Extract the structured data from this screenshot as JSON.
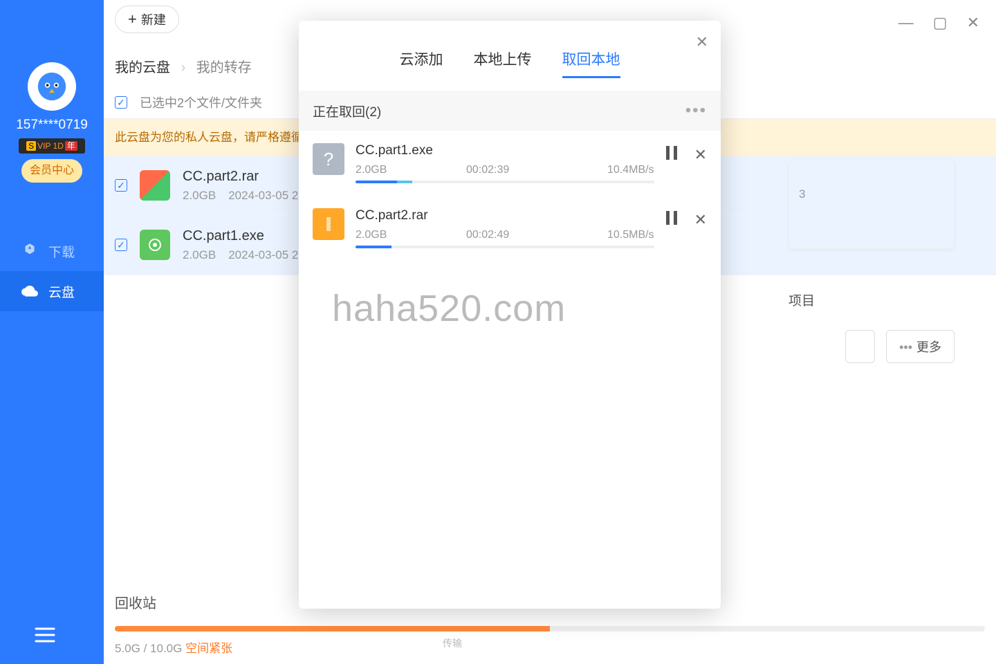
{
  "sidebar": {
    "username": "157****0719",
    "vip_label": "VIP 1D",
    "member_btn": "会员中心",
    "items": [
      {
        "label": "下载"
      },
      {
        "label": "云盘"
      }
    ]
  },
  "topbar": {
    "new_btn": "新建"
  },
  "breadcrumb": {
    "root": "我的云盘",
    "current": "我的转存"
  },
  "select_bar": "已选中2个文件/文件夹",
  "warning": "此云盘为您的私人云盘，请严格遵循服务条款，禁止上传任何涉密、色情、暴力、侵权等违法内容。",
  "files": [
    {
      "name": "CC.part2.rar",
      "size": "2.0GB",
      "date": "2024-03-05 2",
      "icon": "rar"
    },
    {
      "name": "CC.part1.exe",
      "size": "2.0GB",
      "date": "2024-03-05 2",
      "icon": "exe"
    }
  ],
  "dialog": {
    "tabs": [
      "云添加",
      "本地上传",
      "取回本地"
    ],
    "active_tab": 2,
    "header": "正在取回(2)",
    "tasks": [
      {
        "name": "CC.part1.exe",
        "size": "2.0GB",
        "time": "00:02:39",
        "speed": "10.4MB/s",
        "progress_a": 14,
        "progress_b": 5,
        "icon": "unknown"
      },
      {
        "name": "CC.part2.rar",
        "size": "2.0GB",
        "time": "00:02:49",
        "speed": "10.5MB/s",
        "progress_a": 12,
        "progress_b": 0,
        "icon": "rar"
      }
    ]
  },
  "right_peek": {
    "card_suffix": "3",
    "label_suffix": "项目",
    "more_btn": "更多"
  },
  "bottom": {
    "recycle": "回收站",
    "storage_used": "5.0G",
    "storage_sep": " / ",
    "storage_total": "10.0G",
    "storage_warn": "空间紧张",
    "storage_pct": 50
  },
  "watermark": "haha520.com",
  "bottom_tag": "传输"
}
